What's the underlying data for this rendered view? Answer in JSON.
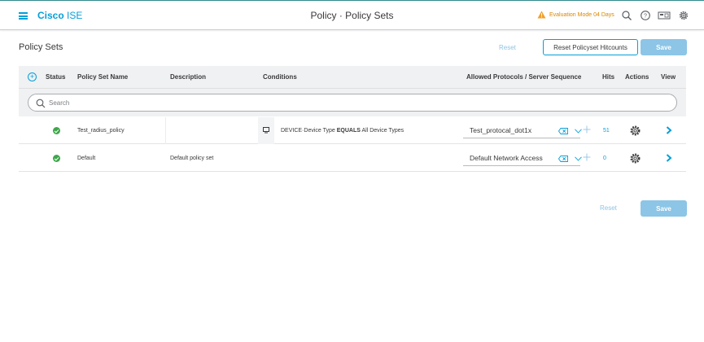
{
  "header": {
    "brand_bold": "Cisco",
    "brand_light": "ISE",
    "page_title": "Policy · Policy Sets",
    "evaluation_text": "Evaluation Mode 04 Days",
    "icons": [
      "menu-icon",
      "warning-icon",
      "search-icon",
      "help-icon",
      "dashboard-icon",
      "settings-icon"
    ]
  },
  "section": {
    "title": "Policy Sets",
    "reset_label": "Reset",
    "reset_hitcounts_label": "Reset Policyset Hitcounts",
    "save_label": "Save"
  },
  "table": {
    "columns": {
      "status": "Status",
      "name": "Policy Set Name",
      "description": "Description",
      "conditions": "Conditions",
      "protocols": "Allowed Protocols / Server Sequence",
      "hits": "Hits",
      "actions": "Actions",
      "view": "View"
    },
    "search_placeholder": "Search",
    "rows": [
      {
        "status": "enabled",
        "name": "Test_radius_policy",
        "description": "",
        "condition_attr": "DEVICE·Device Type",
        "condition_op": "EQUALS",
        "condition_value": "All Device Types",
        "protocol": "Test_protocal_dot1x",
        "hits": "51"
      },
      {
        "status": "enabled",
        "name": "Default",
        "description": "Default policy set",
        "condition_attr": "",
        "condition_op": "",
        "condition_value": "",
        "protocol": "Default Network Access",
        "hits": "0"
      }
    ]
  },
  "footer": {
    "reset_label": "Reset",
    "save_label": "Save"
  },
  "colors": {
    "accent": "#049fd9",
    "save_bg": "#8cc5e6",
    "status_ok": "#3fa64b",
    "warning": "#d98600"
  }
}
